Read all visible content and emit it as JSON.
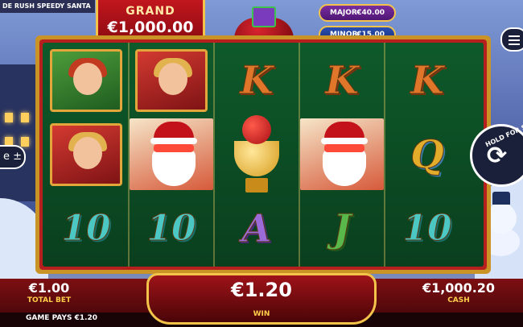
{
  "game": {
    "title": "DE RUSH SPEEDY SANTA"
  },
  "jackpots": {
    "grand": {
      "label": "GRAND",
      "value": "€1,000.00"
    },
    "major": {
      "label": "MAJOR",
      "value": "€40.00"
    },
    "minor": {
      "label": "MINOR",
      "value": "€15.00"
    }
  },
  "side_buttons": {
    "hold_for_spin": "HOLD FOR SE",
    "bet_adjust": "e ±"
  },
  "reels": [
    [
      "elf-male",
      "elf-female",
      "10"
    ],
    [
      "elf-female",
      "santa",
      "10"
    ],
    [
      "K",
      "trophy",
      "A"
    ],
    [
      "K",
      "santa",
      "J"
    ],
    [
      "K",
      "Q",
      "10"
    ]
  ],
  "footer": {
    "total_bet_value": "€1.00",
    "total_bet_label": "TOTAL BET",
    "win_value": "€1.20",
    "win_label": "WIN",
    "cash_value": "€1,000.20",
    "cash_label": "CASH",
    "game_pays": "GAME PAYS €1.20"
  },
  "icons": [
    "menu-icon",
    "spin-icon",
    "gift-sack-icon",
    "star-icon"
  ],
  "colors": {
    "accent_gold": "#f3c34a",
    "panel_red": "#9e1318",
    "reel_green": "#0e5a2a"
  }
}
